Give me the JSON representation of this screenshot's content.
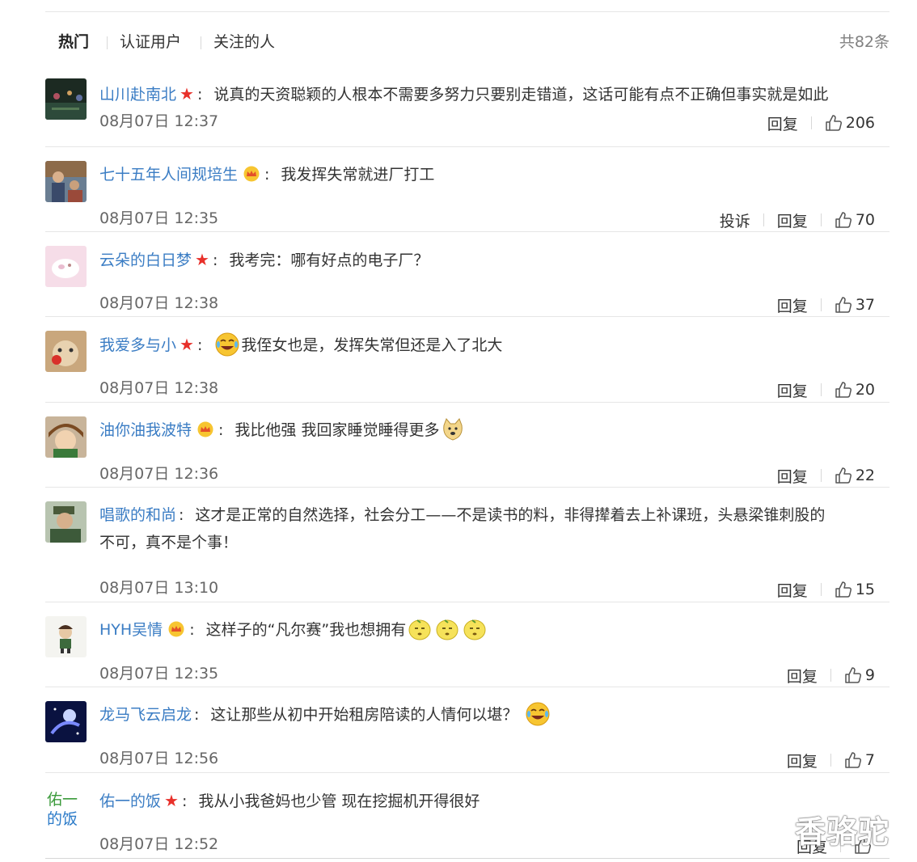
{
  "tabs": [
    {
      "label": "热门",
      "active": true
    },
    {
      "label": "认证用户",
      "active": false
    },
    {
      "label": "关注的人",
      "active": false
    }
  ],
  "total_label": "共82条",
  "reply_label": "回复",
  "report_label": "投诉",
  "comments": [
    {
      "user": "山川赴南北",
      "badge": "star",
      "text": "说真的天资聪颖的人根本不需要多努力只要别走错道，这话可能有点不正确但事实就是如此",
      "time": "08月07日 12:37",
      "likes": "206"
    },
    {
      "user": "七十五年人间规培生",
      "badge": "crown",
      "text": "我发挥失常就进厂打工",
      "time": "08月07日 12:35",
      "likes": "70"
    },
    {
      "user": "云朵的白日梦",
      "badge": "star",
      "text": "我考完：哪有好点的电子厂？",
      "time": "08月07日 12:38",
      "likes": "37"
    },
    {
      "user": "我爱多与小",
      "badge": "star",
      "text": "我侄女也是，发挥失常但还是入了北大",
      "time": "08月07日 12:38",
      "likes": "20"
    },
    {
      "user": "油你油我波特",
      "badge": "crown",
      "text": "我比他强 我回家睡觉睡得更多",
      "time": "08月07日 12:36",
      "likes": "22"
    },
    {
      "user": "唱歌的和尚",
      "badge": "",
      "text": "这才是正常的自然选择，社会分工——不是读书的料，非得撵着去上补课班，头悬梁锥刺股的",
      "text2": "不可，真不是个事！",
      "time": "08月07日 13:10",
      "likes": "15"
    },
    {
      "user": "HYH吴情",
      "badge": "crown",
      "text": "这样子的“凡尔赛”我也想拥有",
      "time": "08月07日 12:35",
      "likes": "9"
    },
    {
      "user": "龙马飞云启龙",
      "badge": "",
      "text": "这让那些从初中开始租房陪读的人情何以堪？",
      "time": "08月07日 12:56",
      "likes": "7"
    },
    {
      "user": "佑一的饭",
      "badge": "star",
      "text": "我从小我爸妈也少管 现在挖掘机开得很好",
      "time": "08月07日 12:52",
      "likes": ""
    }
  ],
  "avatar_text_last": "佑一的饭",
  "watermark": "香骆驼",
  "colors": {
    "username": "#3b7dc4",
    "star": "#e8302a",
    "crown": "#f0a51a",
    "divider": "#e6e6e6"
  },
  "icons": [
    "thumbs-up-icon",
    "star-badge-icon",
    "crown-badge-icon",
    "laugh-cry-emoji",
    "doge-emoji",
    "lemon-emoji"
  ]
}
